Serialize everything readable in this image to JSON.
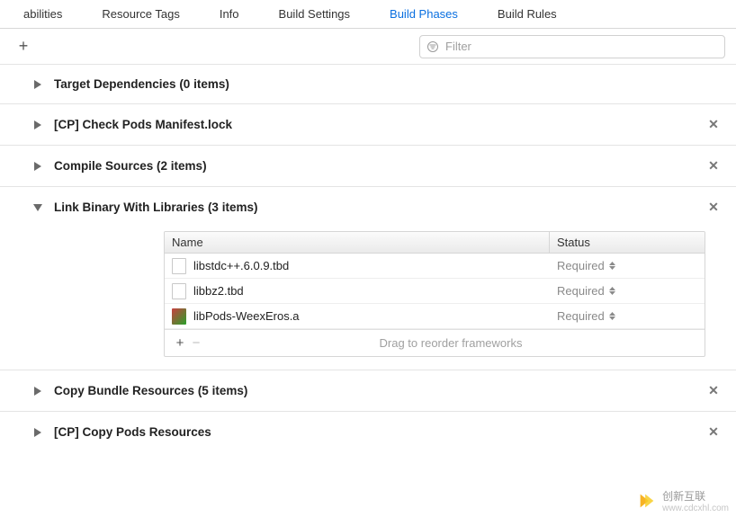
{
  "tabs": {
    "items": [
      {
        "label": "abilities"
      },
      {
        "label": "Resource Tags"
      },
      {
        "label": "Info"
      },
      {
        "label": "Build Settings"
      },
      {
        "label": "Build Phases"
      },
      {
        "label": "Build Rules"
      }
    ],
    "active_index": 4
  },
  "filter": {
    "placeholder": "Filter"
  },
  "phases": [
    {
      "title": "Target Dependencies",
      "count": "(0 items)",
      "expanded": false,
      "closable": false
    },
    {
      "title": "[CP] Check Pods Manifest.lock",
      "count": "",
      "expanded": false,
      "closable": true
    },
    {
      "title": "Compile Sources",
      "count": "(2 items)",
      "expanded": false,
      "closable": true
    },
    {
      "title": "Link Binary With Libraries",
      "count": "(3 items)",
      "expanded": true,
      "closable": true
    },
    {
      "title": "Copy Bundle Resources",
      "count": "(5 items)",
      "expanded": false,
      "closable": true
    },
    {
      "title": "[CP] Copy Pods Resources",
      "count": "",
      "expanded": false,
      "closable": true
    }
  ],
  "link_table": {
    "columns": {
      "name": "Name",
      "status": "Status"
    },
    "rows": [
      {
        "icon": "blank",
        "name": "libstdc++.6.0.9.tbd",
        "status": "Required"
      },
      {
        "icon": "blank",
        "name": "libbz2.tbd",
        "status": "Required"
      },
      {
        "icon": "lib",
        "name": "libPods-WeexEros.a",
        "status": "Required"
      }
    ],
    "footer_hint": "Drag to reorder frameworks"
  },
  "watermark": {
    "text1": "创新互联",
    "text2": "www.cdcxhl.com"
  }
}
